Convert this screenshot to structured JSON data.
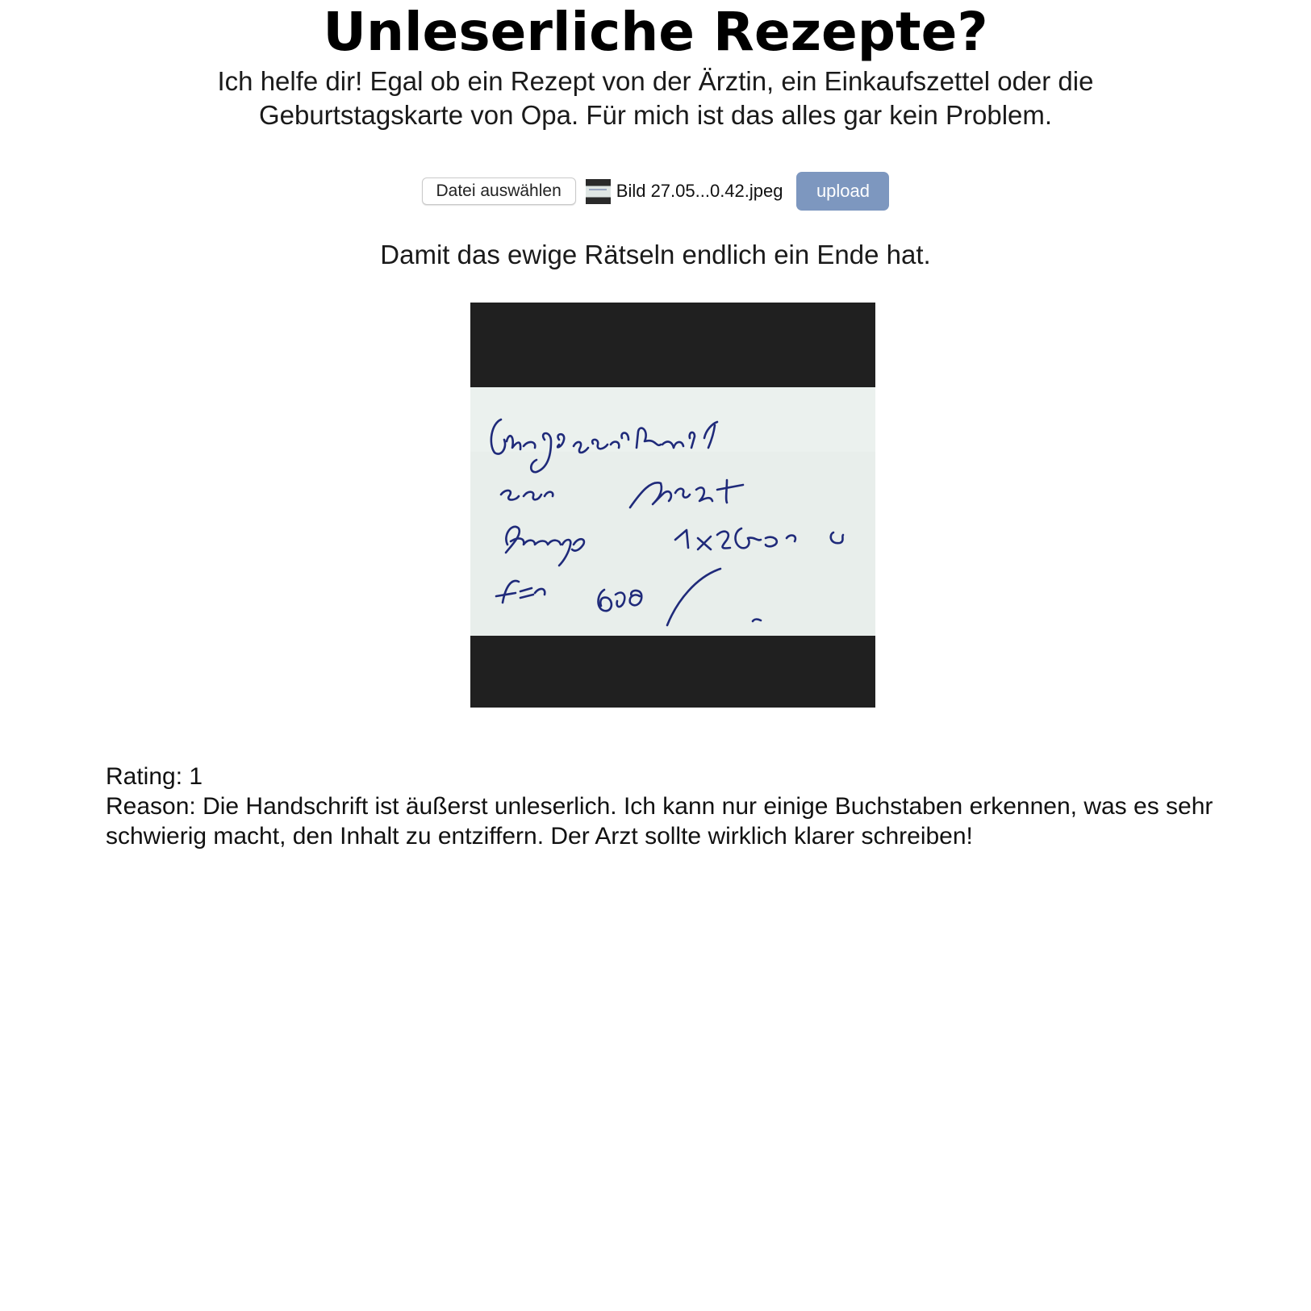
{
  "header": {
    "title": "Unleserliche Rezepte?",
    "intro": "Ich helfe dir! Egal ob ein Rezept von der Ärztin, ein Einkaufszettel oder die Geburtstagskarte von Opa. Für mich ist das alles gar kein Problem."
  },
  "upload": {
    "choose_label": "Datei auswählen",
    "file_name": "Bild 27.05...0.42.jpeg",
    "upload_label": "upload"
  },
  "tagline": "Damit das ewige Rätseln endlich ein Ende hat.",
  "result": {
    "rating": "Rating: 1",
    "reason": "Reason: Die Handschrift ist äußerst unleserlich. Ich kann nur einige Buchstaben erkennen, was es sehr schwierig macht, den Inhalt zu entziffern. Der Arzt sollte wirklich klarer schreiben!"
  },
  "colors": {
    "upload_button": "#7d97bf",
    "preview_frame": "#202020",
    "note_paper": "#e8eeeb",
    "ink": "#1f2a7a"
  }
}
